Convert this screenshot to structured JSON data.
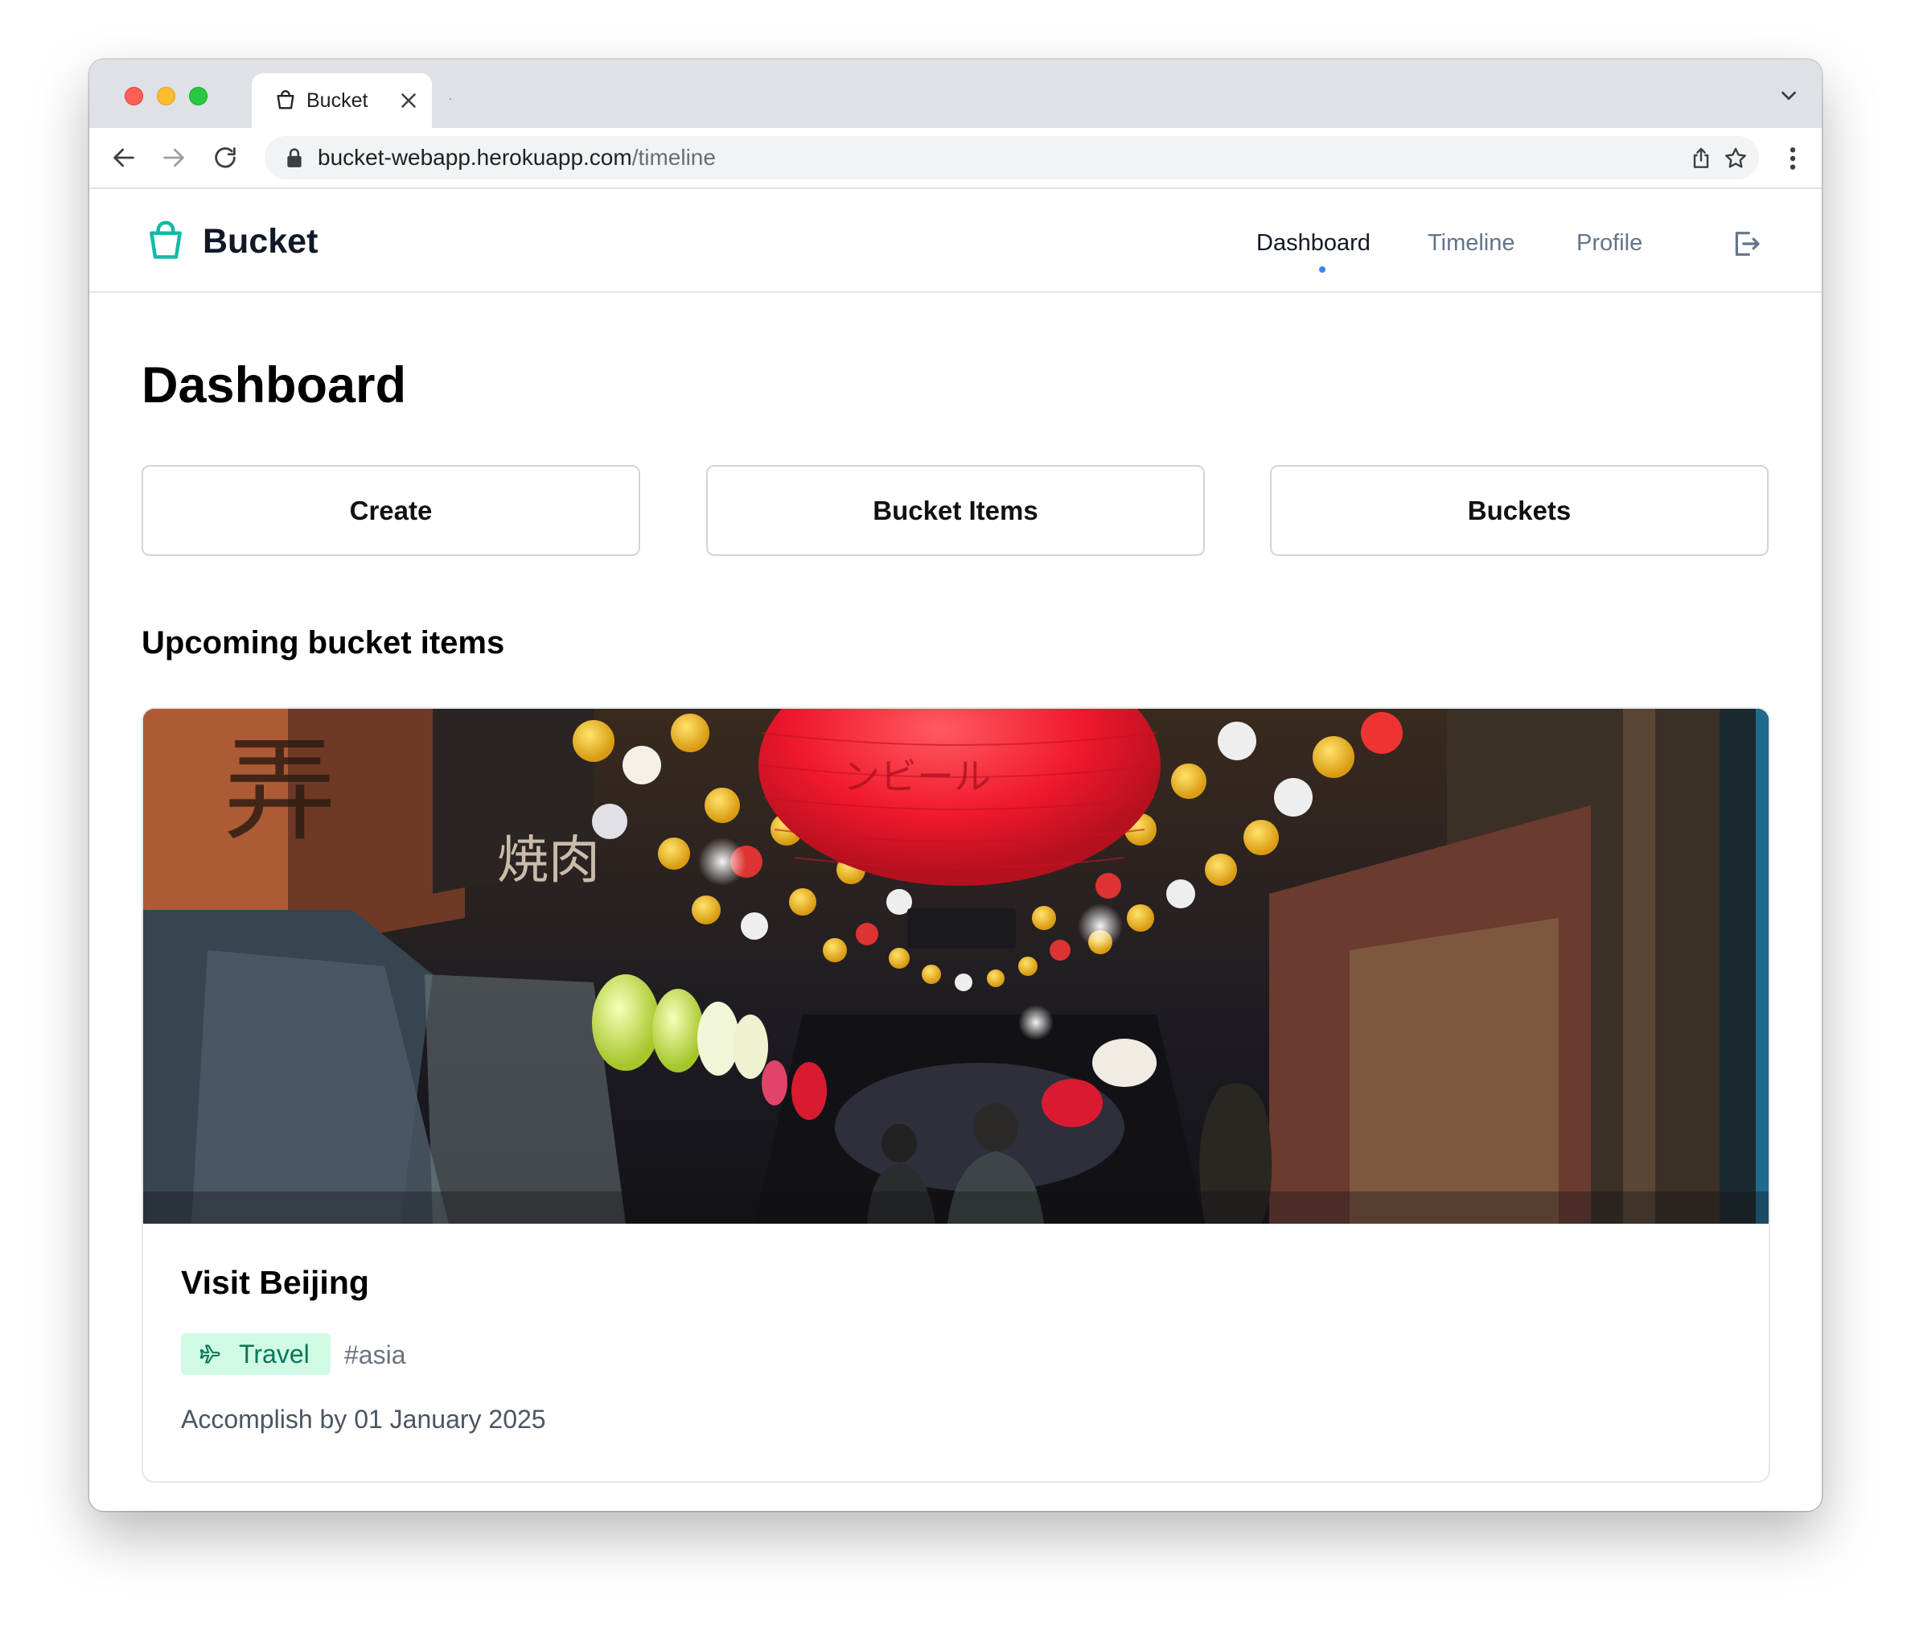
{
  "browser": {
    "tab_title": "Bucket",
    "url_host": "bucket-webapp.herokuapp.com",
    "url_path": "/timeline",
    "icons": [
      "bucket-icon",
      "close-icon",
      "chevron-down-icon",
      "back-arrow-icon",
      "forward-arrow-icon",
      "reload-icon",
      "lock-icon",
      "share-icon",
      "star-icon",
      "more-vertical-icon"
    ]
  },
  "app": {
    "brand": "Bucket",
    "brand_color": "#14b8a6",
    "nav": {
      "items": [
        {
          "label": "Dashboard",
          "active": true
        },
        {
          "label": "Timeline",
          "active": false
        },
        {
          "label": "Profile",
          "active": false
        }
      ],
      "logout_icon": "logout-icon",
      "active_indicator_color": "#3b82f6"
    }
  },
  "dashboard": {
    "title": "Dashboard",
    "actions": [
      "Create",
      "Bucket Items",
      "Buckets"
    ],
    "section_title": "Upcoming bucket items",
    "items": [
      {
        "title": "Visit Beijing",
        "category": "Travel",
        "category_icon": "airplane-icon",
        "category_color": "#047857",
        "category_bg": "#d1fae5",
        "tag": "#asia",
        "due": "Accomplish by 01 January 2025",
        "image": "night market alley with hanging lanterns"
      }
    ]
  }
}
